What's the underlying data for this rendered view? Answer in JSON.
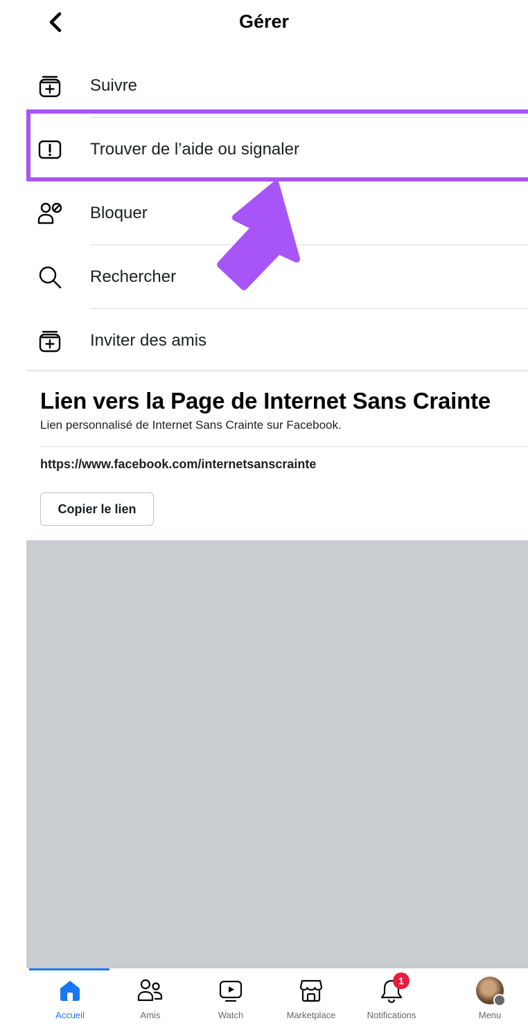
{
  "header": {
    "title": "Gérer"
  },
  "menu": {
    "items": [
      {
        "label": "Suivre",
        "icon": "add-square-icon"
      },
      {
        "label": "Trouver de l’aide ou signaler",
        "icon": "report-icon"
      },
      {
        "label": "Bloquer",
        "icon": "block-user-icon"
      },
      {
        "label": "Rechercher",
        "icon": "search-icon"
      },
      {
        "label": "Inviter des amis",
        "icon": "invite-icon"
      }
    ]
  },
  "link_section": {
    "title": "Lien vers la Page de Internet Sans Crainte",
    "subtitle": "Lien personnalisé de Internet Sans Crainte sur Facebook.",
    "url": "https://www.facebook.com/internetsanscrainte",
    "copy_label": "Copier le lien"
  },
  "tabbar": {
    "tabs": [
      {
        "label": "Accueil",
        "icon": "home-icon",
        "active": true
      },
      {
        "label": "Amis",
        "icon": "friends-icon"
      },
      {
        "label": "Watch",
        "icon": "watch-icon"
      },
      {
        "label": "Marketplace",
        "icon": "marketplace-icon"
      },
      {
        "label": "Notifications",
        "icon": "bell-icon",
        "badge": "1"
      },
      {
        "label": "Menu",
        "icon": "avatar"
      }
    ]
  },
  "colors": {
    "accent": "#1877f2",
    "highlight": "#a855f7",
    "badge": "#e41e3f",
    "gray_area": "#c9ccd1"
  }
}
